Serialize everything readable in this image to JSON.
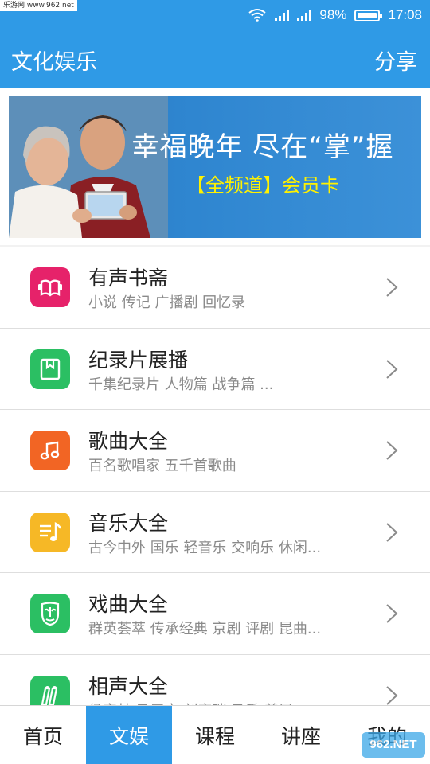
{
  "status_bar": {
    "watermark": "乐游网 www.962.net",
    "battery_percent": "98%",
    "battery_level": 0.98,
    "time": "17:08"
  },
  "header": {
    "title": "文化娱乐",
    "share_label": "分享"
  },
  "banner": {
    "headline": "幸福晚年 尽在“掌”握",
    "subline": "【全频道】会员卡"
  },
  "list": {
    "items": [
      {
        "title": "有声书斋",
        "subtitle": "小说 传记 广播剧 回忆录",
        "icon": "audiobook-icon",
        "color": "#e6226a"
      },
      {
        "title": "纪录片展播",
        "subtitle": "千集纪录片 人物篇 战争篇 ...",
        "icon": "documentary-icon",
        "color": "#2bbf63"
      },
      {
        "title": "歌曲大全",
        "subtitle": "百名歌唱家 五千首歌曲",
        "icon": "music-note-icon",
        "color": "#f26524"
      },
      {
        "title": "音乐大全",
        "subtitle": "古今中外 国乐 轻音乐 交响乐 休闲...",
        "icon": "music-list-icon",
        "color": "#f6b826"
      },
      {
        "title": "戏曲大全",
        "subtitle": "群英荟萃 传承经典 京剧 评剧 昆曲...",
        "icon": "opera-mask-icon",
        "color": "#2bbf63"
      },
      {
        "title": "相声大全",
        "subtitle": "侯宝林 马三立 刘宝瑞 马季 姜昆",
        "icon": "crosstalk-icon",
        "color": "#2bbf63"
      }
    ]
  },
  "bottom_nav": {
    "tabs": [
      {
        "label": "首页"
      },
      {
        "label": "文娱"
      },
      {
        "label": "课程"
      },
      {
        "label": "讲座"
      },
      {
        "label": "我的"
      }
    ],
    "active_index": 1
  },
  "colors": {
    "primary": "#2f9ae6",
    "banner_sub": "#fff200"
  }
}
